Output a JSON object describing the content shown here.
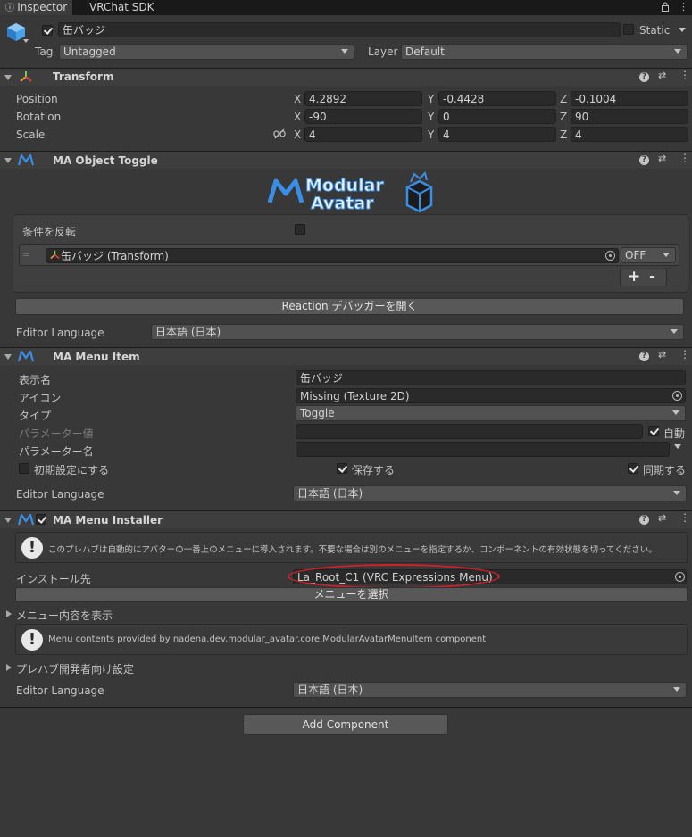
{
  "tabs": [
    {
      "label": "Inspector"
    },
    {
      "label": "VRChat SDK"
    }
  ],
  "object": {
    "name": "缶バッジ",
    "static_label": "Static",
    "tag_label": "Tag",
    "tag_value": "Untagged",
    "layer_label": "Layer",
    "layer_value": "Default"
  },
  "transform": {
    "title": "Transform",
    "rows": [
      {
        "label": "Position",
        "x": "4.2892",
        "y": "-0.4428",
        "z": "-0.1004"
      },
      {
        "label": "Rotation",
        "x": "-90",
        "y": "0",
        "z": "90"
      },
      {
        "label": "Scale",
        "x": "4",
        "y": "4",
        "z": "4"
      }
    ],
    "axis": {
      "x": "X",
      "y": "Y",
      "z": "Z"
    }
  },
  "object_toggle": {
    "title": "MA Object Toggle",
    "logo_line1": "Modular",
    "logo_line2": "Avatar",
    "invert_label": "条件を反転",
    "entry_object": "缶バッジ (Transform)",
    "entry_state": "OFF",
    "plus": "+",
    "minus": "-",
    "debugger_button": "Reaction デバッガーを開く",
    "lang_label": "Editor Language",
    "lang_value": "日本語 (日本)"
  },
  "menu_item": {
    "title": "MA Menu Item",
    "display_name_label": "表示名",
    "display_name_value": "缶バッジ",
    "icon_label": "アイコン",
    "icon_value": "Missing (Texture 2D)",
    "type_label": "タイプ",
    "type_value": "Toggle",
    "param_value_label": "パラメーター値",
    "auto_label": "自動",
    "param_name_label": "パラメーター名",
    "default_label": "初期設定にする",
    "save_label": "保存する",
    "sync_label": "同期する",
    "lang_label": "Editor Language",
    "lang_value": "日本語 (日本)"
  },
  "menu_installer": {
    "title": "MA Menu Installer",
    "info_text": "このプレハブは自動的にアバターの一番上のメニューに導入されます。不要な場合は別のメニューを指定するか、コンポーネントの有効状態を切ってください。",
    "install_label": "インストール先",
    "install_value": "La_Root_C1 (VRC Expressions Menu)",
    "select_button": "メニューを選択",
    "show_contents": "メニュー内容を表示",
    "contents_info": "Menu contents provided by nadena.dev.modular_avatar.core.ModularAvatarMenuItem component",
    "prefab_dev": "プレハブ開発者向け設定",
    "lang_label": "Editor Language",
    "lang_value": "日本語 (日本)"
  },
  "add_component": "Add Component",
  "colors": {
    "accent": "#3a8ee6",
    "annotation": "#d0202a",
    "bg": "#383838"
  }
}
